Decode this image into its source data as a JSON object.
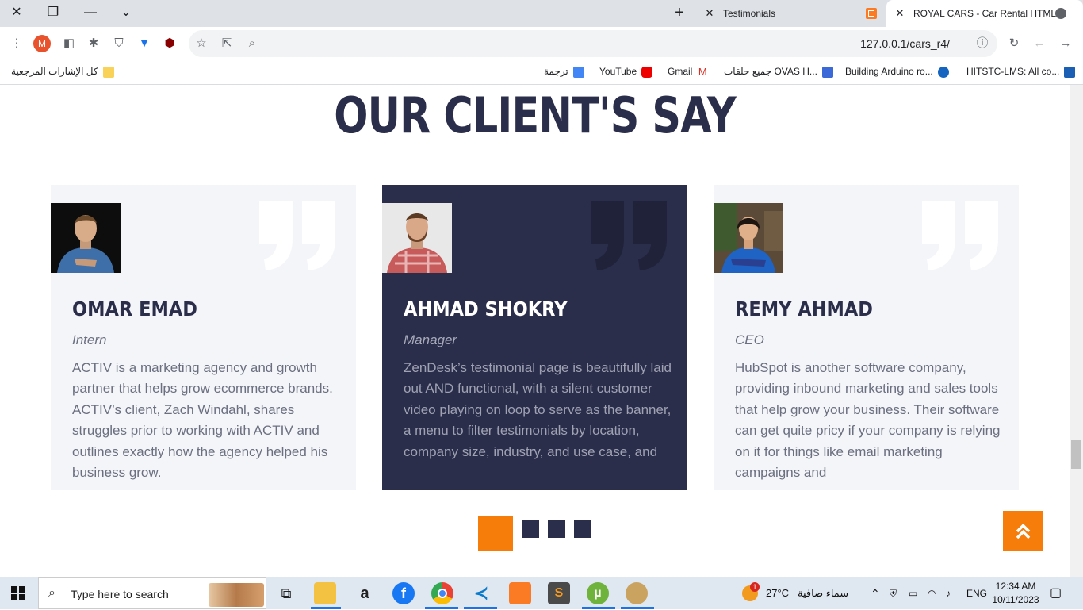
{
  "browser": {
    "tabs": [
      {
        "title": "Testimonials"
      },
      {
        "title": "ROYAL CARS - Car Rental HTML"
      }
    ],
    "url": "127.0.0.1/cars_r4/",
    "bookmarks": [
      {
        "label": "HITSTC-LMS: All co..."
      },
      {
        "label": "Building Arduino ro..."
      },
      {
        "label": "جميع حلقات OVAS H..."
      },
      {
        "label": "Gmail"
      },
      {
        "label": "YouTube"
      },
      {
        "label": "ترجمة"
      },
      {
        "label": "كل الإشارات المرجعية"
      }
    ]
  },
  "section": {
    "title": "OUR CLIENT'S SAY"
  },
  "testimonials": [
    {
      "name": "OMAR EMAD",
      "role": "Intern",
      "text": "ACTIV is a marketing agency and growth partner that helps grow ecommerce brands. ACTIV’s client, Zach Windahl, shares struggles prior to working with ACTIV and outlines exactly how the agency helped his business grow.",
      "highlighted": false
    },
    {
      "name": "AHMAD SHOKRY",
      "role": "Manager",
      "text": "ZenDesk’s testimonial page is beautifully laid out AND functional, with a silent customer video playing on loop to serve as the banner, a menu to filter testimonials by location, company size, industry, and use case, and",
      "highlighted": true
    },
    {
      "name": "REMY AHMAD",
      "role": "CEO",
      "text": "HubSpot is another software company, providing inbound marketing and sales tools that help grow your business. Their software can get quite pricy if your company is relying on it for things like email marketing campaigns and",
      "highlighted": false
    }
  ],
  "carousel": {
    "dots": 4,
    "active_index": 0
  },
  "colors": {
    "navy": "#2b2e4a",
    "accent": "#f77d0a",
    "card_bg": "#f4f5f8"
  },
  "taskbar": {
    "search_placeholder": "Type here to search",
    "weather_temp": "27°C",
    "weather_text": "سماء صافية",
    "language": "ENG",
    "time": "12:34 AM",
    "date": "10/11/2023",
    "notification_count": "1"
  }
}
